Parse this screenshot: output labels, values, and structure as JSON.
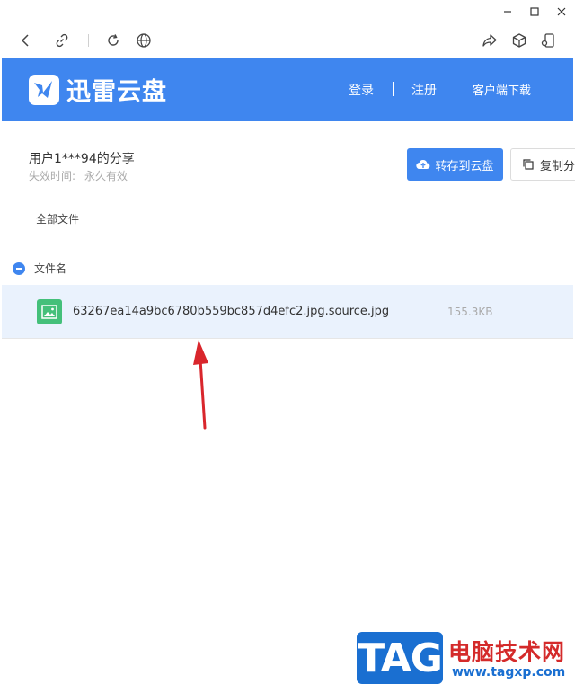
{
  "header": {
    "brand": "迅雷云盘",
    "login": "登录",
    "divider": "|",
    "register": "注册",
    "download_client": "客户端下载"
  },
  "share": {
    "title": "用户1***94的分享",
    "expire_label": "失效时间:",
    "expire_value": "永久有效",
    "save_button": "转存到云盘",
    "copy_button": "复制分"
  },
  "breadcrumb": "全部文件",
  "list": {
    "column_name": "文件名",
    "files": [
      {
        "name": "63267ea14a9bc6780b559bc857d4efc2.jpg.source.jpg",
        "size": "155.3KB"
      }
    ]
  },
  "watermark": {
    "tag": "TAG",
    "site": "电脑技术网",
    "url": "www.tagxp.com"
  },
  "colors": {
    "brand_blue": "#3f86ef",
    "row_highlight": "#eaf2fd",
    "file_icon_green": "#44c07a",
    "annotation_red": "#d9262c"
  }
}
